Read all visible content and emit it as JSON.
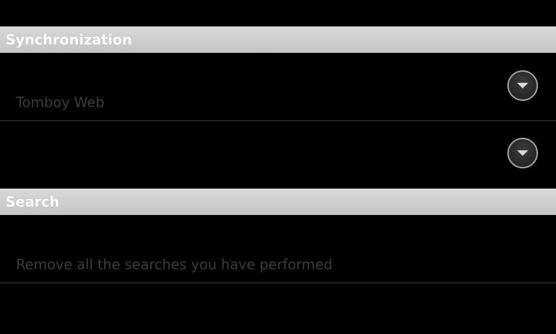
{
  "sections": {
    "sync": {
      "title": "Synchronization"
    },
    "search": {
      "title": "Search"
    }
  },
  "preferences": {
    "sync_service": {
      "summary": "Tomboy Web",
      "icon": "chevron-down-icon"
    },
    "sync_option": {
      "summary": "",
      "icon": "chevron-down-icon"
    },
    "clear_searches": {
      "summary": "Remove all the searches you have performed"
    }
  },
  "colors": {
    "background": "#000000",
    "header_bg": "#cfcfcf",
    "header_text": "#ffffff",
    "summary_text": "#3c3c3c",
    "divider": "#3d3d3d"
  }
}
